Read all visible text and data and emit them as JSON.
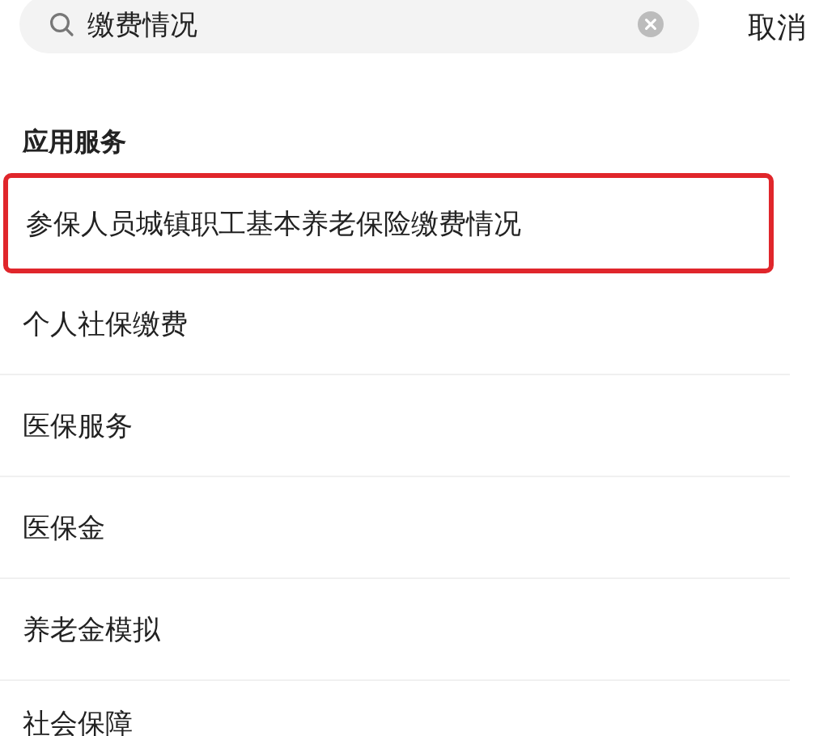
{
  "search": {
    "value": "缴费情况",
    "cancel": "取消"
  },
  "section": {
    "title": "应用服务"
  },
  "results": [
    {
      "label": "参保人员城镇职工基本养老保险缴费情况",
      "highlighted": true
    },
    {
      "label": "个人社保缴费",
      "highlighted": false
    },
    {
      "label": "医保服务",
      "highlighted": false
    },
    {
      "label": "医保金",
      "highlighted": false
    },
    {
      "label": "养老金模拟",
      "highlighted": false
    },
    {
      "label": "社会保障",
      "highlighted": false
    }
  ]
}
